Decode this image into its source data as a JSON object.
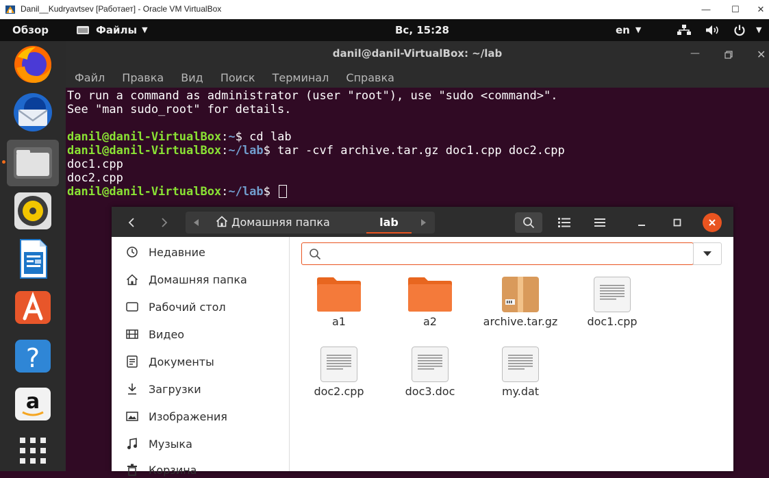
{
  "host_window": {
    "title": "Danil__Kudryavtsev [Работает] - Oracle VM VirtualBox",
    "controls": [
      "—",
      "☐",
      "✕"
    ]
  },
  "topbar": {
    "activities": "Обзор",
    "app_menu": "Файлы",
    "clock": "Вс, 15:28",
    "lang": "en"
  },
  "dock": {
    "items": [
      "firefox-icon",
      "thunderbird-icon",
      "files-icon",
      "rhythmbox-icon",
      "writer-icon",
      "software-icon",
      "help-icon",
      "amazon-icon",
      "app-grid-icon"
    ],
    "active": "files-icon"
  },
  "terminal": {
    "title": "danil@danil-VirtualBox: ~/lab",
    "menu": [
      "Файл",
      "Правка",
      "Вид",
      "Поиск",
      "Терминал",
      "Справка"
    ],
    "info_lines": [
      "To run a command as administrator (user \"root\"), use \"sudo <command>\".",
      "See \"man sudo_root\" for details."
    ],
    "prompt_user": "danil@danil-VirtualBox",
    "sessions": [
      {
        "path": "~",
        "command": "cd lab"
      },
      {
        "path": "~/lab",
        "command": "tar -cvf archive.tar.gz doc1.cpp doc2.cpp"
      }
    ],
    "output_lines": [
      "doc1.cpp",
      "doc2.cpp"
    ],
    "final_path": "~/lab"
  },
  "files": {
    "breadcrumb_home": "Домашняя папка",
    "breadcrumb_current": "lab",
    "sidebar": [
      "Недавние",
      "Домашняя папка",
      "Рабочий стол",
      "Видео",
      "Документы",
      "Загрузки",
      "Изображения",
      "Музыка",
      "Корзина"
    ],
    "search_placeholder": "",
    "items": [
      {
        "name": "a1",
        "type": "folder"
      },
      {
        "name": "a2",
        "type": "folder"
      },
      {
        "name": "archive.tar.gz",
        "type": "archive"
      },
      {
        "name": "doc1.cpp",
        "type": "text"
      },
      {
        "name": "doc2.cpp",
        "type": "text"
      },
      {
        "name": "doc3.doc",
        "type": "text"
      },
      {
        "name": "my.dat",
        "type": "text"
      }
    ]
  },
  "colors": {
    "accent": "#e95420",
    "terminal_bg": "#300a24",
    "prompt_green": "#8ae234",
    "prompt_blue": "#729fcf",
    "folder_orange": "#f47a3a"
  }
}
